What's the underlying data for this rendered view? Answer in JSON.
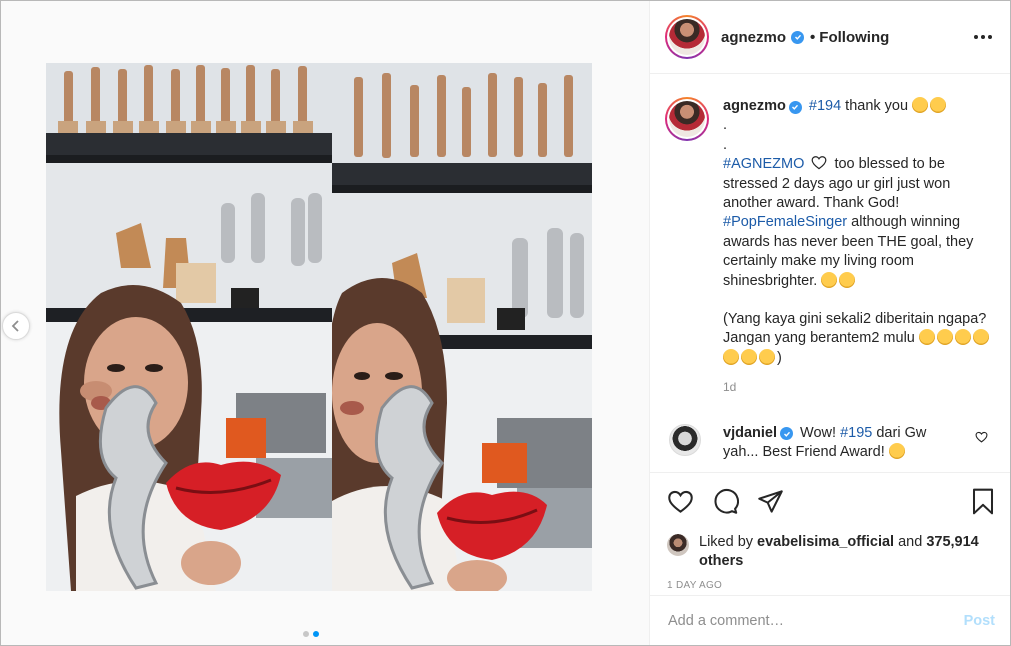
{
  "post": {
    "username": "agnezmo",
    "follow_separator": "•",
    "follow_label": "Following"
  },
  "caption": {
    "username": "agnezmo",
    "hashtag_1": "#194",
    "text_1": "thank you",
    "line_dot_1": ".",
    "line_dot_2": ".",
    "hashtag_2": "#AGNEZMO",
    "text_2": "too blessed to be stressed 2 days ago ur girl just won another award. Thank God!",
    "hashtag_3": "#PopFemaleSinger",
    "text_3": "although winning awards has never been THE goal, they certainly make my living room shinesbrighter.",
    "text_4": "(Yang kaya gini sekali2 diberitain ngapa? Jangan yang berantem2 mulu",
    "text_4_end": ")",
    "age": "1d"
  },
  "comment": {
    "username": "vjdaniel",
    "text_1": "Wow!",
    "hashtag": "#195",
    "text_2": "dari Gw yah... Best Friend Award!"
  },
  "likes": {
    "prefix": "Liked by",
    "user": "evabelisima_official",
    "and": "and",
    "count": "375,914 others"
  },
  "timestamp": "1 DAY AGO",
  "add_comment": {
    "placeholder": "Add a comment…",
    "post_label": "Post"
  },
  "carousel": {
    "slide_count": 2,
    "active_index": 1
  },
  "colors": {
    "link": "#1c5ba8",
    "verified": "#3897f0",
    "post_disabled": "#b2dffc",
    "muted": "#8e8e8e"
  },
  "icons": [
    "verified-icon",
    "more-options-icon",
    "heart-icon",
    "comment-icon",
    "share-icon",
    "save-bookmark-icon",
    "chevron-left-icon",
    "heart-outline-emoji-icon"
  ]
}
